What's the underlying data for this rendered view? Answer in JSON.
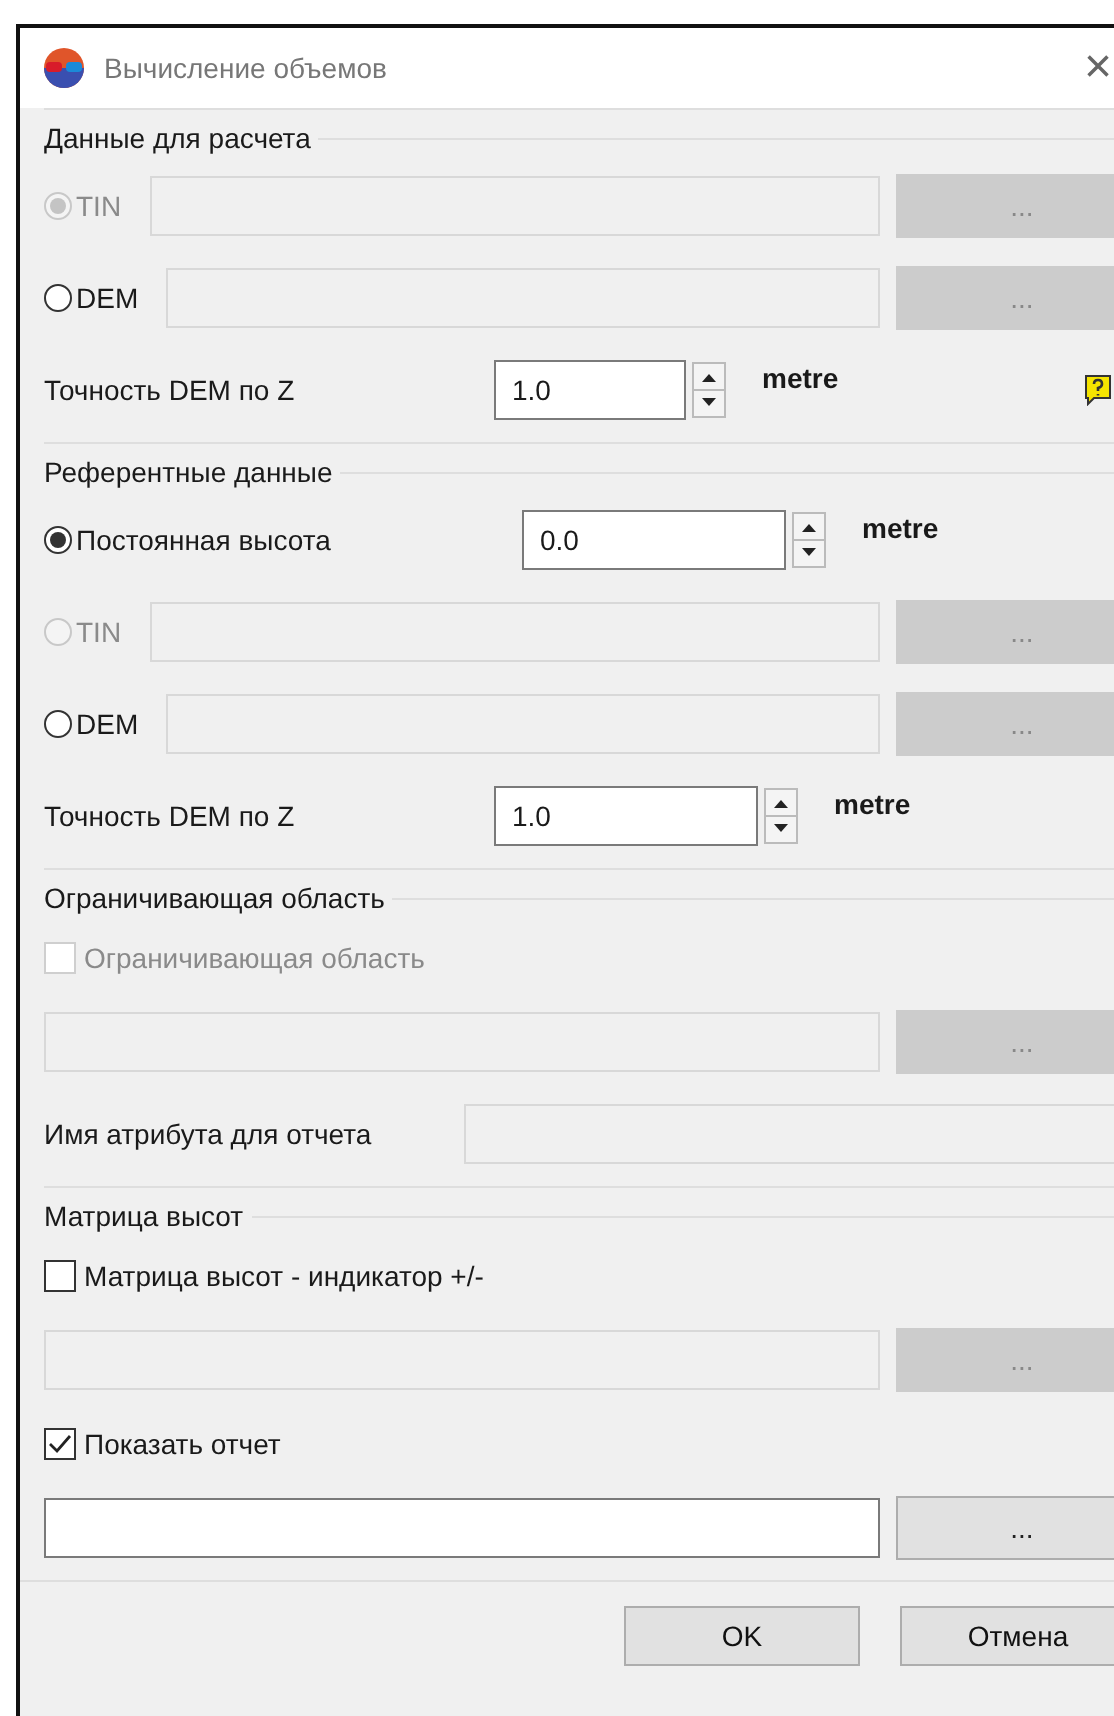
{
  "window": {
    "title": "Вычисление объемов",
    "close": "×"
  },
  "sections": [
    {
      "title": "Данные для расчета",
      "rows": [
        {
          "kind": "radio-file",
          "label": "TIN",
          "selected": true,
          "disabled": true,
          "button": "..."
        },
        {
          "kind": "radio-file",
          "label": "DEM",
          "selected": false,
          "disabled": false,
          "button": "..."
        },
        {
          "kind": "spin",
          "label": "Точность DEM по Z",
          "value": "1.0",
          "unit": "metre",
          "help": true
        }
      ]
    },
    {
      "title": "Референтные данные",
      "rows": [
        {
          "kind": "radio-spin",
          "label": "Постоянная высота",
          "selected": true,
          "disabled": false,
          "value": "0.0",
          "unit": "metre"
        },
        {
          "kind": "radio-file",
          "label": "TIN",
          "selected": false,
          "disabled": true,
          "button": "..."
        },
        {
          "kind": "radio-file",
          "label": "DEM",
          "selected": false,
          "disabled": false,
          "button": "..."
        },
        {
          "kind": "spin",
          "label": "Точность DEM по Z",
          "value": "1.0",
          "unit": "metre",
          "help": false
        }
      ]
    },
    {
      "title": "Ограничивающая область",
      "rows": [
        {
          "kind": "checkbox",
          "label": "Ограничивающая область",
          "checked": false,
          "disabled": true
        },
        {
          "kind": "file",
          "enabled": false,
          "button": "..."
        },
        {
          "kind": "text",
          "label": "Имя атрибута для отчета"
        }
      ]
    },
    {
      "title": "Матрица высот",
      "rows": [
        {
          "kind": "checkbox",
          "label": "Матрица высот - индикатор +/-",
          "checked": false,
          "disabled": false
        },
        {
          "kind": "file",
          "enabled": false,
          "button": "..."
        },
        {
          "kind": "checkbox",
          "label": "Показать отчет",
          "checked": true,
          "disabled": false
        },
        {
          "kind": "file",
          "enabled": true,
          "button": "..."
        }
      ]
    }
  ],
  "buttons": [
    "OK",
    "Отмена"
  ]
}
